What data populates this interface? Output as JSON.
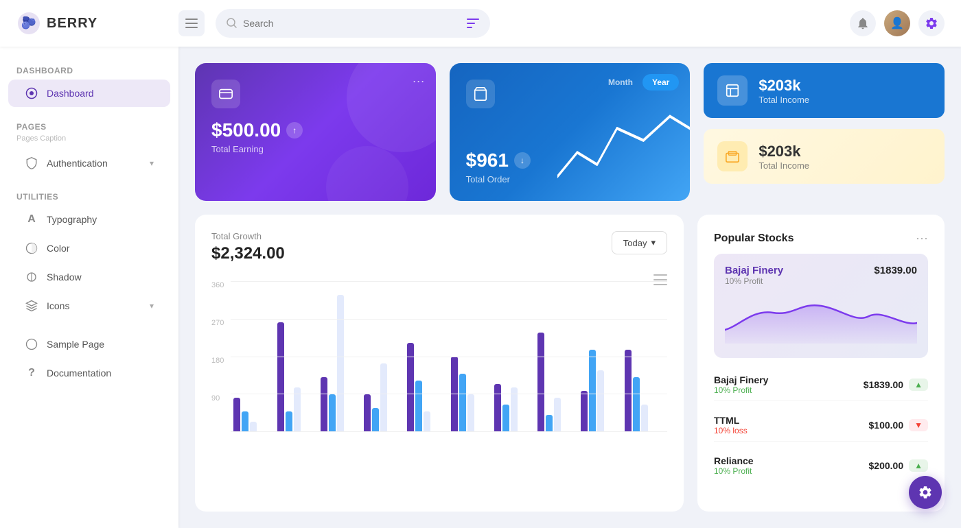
{
  "app": {
    "name": "BERRY"
  },
  "header": {
    "search_placeholder": "Search",
    "hamburger_icon": "☰",
    "notif_icon": "🔔",
    "settings_icon": "⚙"
  },
  "sidebar": {
    "sections": [
      {
        "title": "Dashboard",
        "items": [
          {
            "id": "dashboard",
            "label": "Dashboard",
            "icon": "◎",
            "active": true
          }
        ]
      },
      {
        "title": "Pages",
        "caption": "Pages Caption",
        "items": [
          {
            "id": "authentication",
            "label": "Authentication",
            "icon": "🔑",
            "has_chevron": true
          }
        ]
      },
      {
        "title": "Utilities",
        "items": [
          {
            "id": "typography",
            "label": "Typography",
            "icon": "A"
          },
          {
            "id": "color",
            "label": "Color",
            "icon": "◑"
          },
          {
            "id": "shadow",
            "label": "Shadow",
            "icon": "◎"
          },
          {
            "id": "icons",
            "label": "Icons",
            "icon": "✦",
            "has_chevron": true
          }
        ]
      },
      {
        "title": "",
        "items": [
          {
            "id": "sample",
            "label": "Sample Page",
            "icon": "◎"
          },
          {
            "id": "docs",
            "label": "Documentation",
            "icon": "?"
          }
        ]
      }
    ]
  },
  "cards": {
    "earning": {
      "amount": "$500.00",
      "label": "Total Earning",
      "trend": "↑",
      "menu": "···"
    },
    "order": {
      "amount": "$961",
      "label": "Total Order",
      "toggle_month": "Month",
      "toggle_year": "Year",
      "trend": "↓"
    },
    "income1": {
      "amount": "$203k",
      "label": "Total Income"
    },
    "income2": {
      "amount": "$203k",
      "label": "Total Income"
    }
  },
  "growth_chart": {
    "title": "Total Growth",
    "amount": "$2,324.00",
    "period_btn": "Today",
    "y_labels": [
      "360",
      "270",
      "180",
      "90"
    ],
    "menu_icon": "≡"
  },
  "stocks": {
    "title": "Popular Stocks",
    "menu": "···",
    "featured": {
      "name": "Bajaj Finery",
      "price": "$1839.00",
      "sub": "10% Profit"
    },
    "rows": [
      {
        "name": "Bajaj Finery",
        "price": "$1839.00",
        "sub": "10% Profit",
        "trend": "up"
      },
      {
        "name": "TTML",
        "price": "$100.00",
        "sub": "10% loss",
        "trend": "down"
      },
      {
        "name": "Reliance",
        "price": "$200.00",
        "sub": "10% Profit",
        "trend": "up"
      }
    ]
  }
}
